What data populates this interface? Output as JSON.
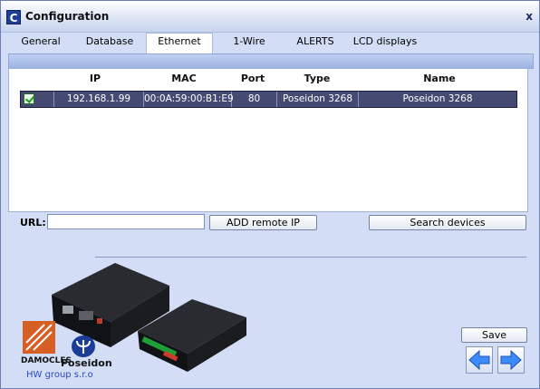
{
  "window": {
    "title": "Configuration",
    "icon_letter": "C",
    "close_label": "x"
  },
  "tabs": [
    {
      "label": "General"
    },
    {
      "label": "Database"
    },
    {
      "label": "Ethernet"
    },
    {
      "label": "1-Wire"
    },
    {
      "label": "ALERTS"
    },
    {
      "label": "LCD displays"
    }
  ],
  "active_tab": "Ethernet",
  "table": {
    "columns": [
      "IP",
      "MAC",
      "Port",
      "Type",
      "Name"
    ],
    "rows": [
      {
        "checked": true,
        "ip": "192.168.1.99",
        "mac": "00:0A:59:00:B1:E9",
        "port": "80",
        "type": "Poseidon 3268",
        "name": "Poseidon 3268"
      }
    ]
  },
  "url": {
    "label": "URL:",
    "value": ""
  },
  "buttons": {
    "add_remote_ip": "ADD remote IP",
    "search_devices": "Search devices",
    "save": "Save"
  },
  "branding": {
    "damocles": "DAMOCLES",
    "poseidon": "Poseidon",
    "company": "HW group s.r.o"
  },
  "icons": {
    "back": "arrow-left-icon",
    "forward": "arrow-right-icon",
    "checkbox": "checkbox-checked-icon"
  },
  "colors": {
    "selected_row": "#454a73",
    "window_bg": "#d3def6",
    "nav_arrow": "#3b8bff"
  }
}
